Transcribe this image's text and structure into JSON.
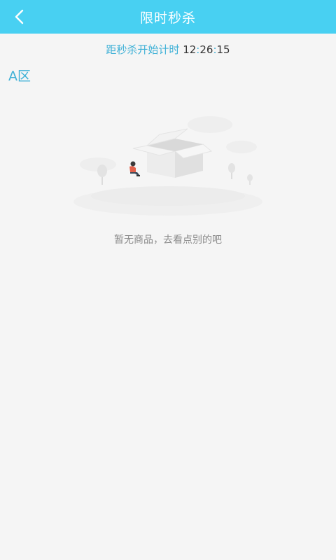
{
  "header": {
    "title": "限时秒杀",
    "back_icon": "chevron-left-icon"
  },
  "countdown": {
    "label": "距秒杀开始计时",
    "hours": "12",
    "minutes": "26",
    "seconds": "15",
    "separator": ":"
  },
  "zone": {
    "label": "A区"
  },
  "empty": {
    "illustration": "empty-box-illustration",
    "message": "暂无商品，去看点别的吧"
  },
  "colors": {
    "header_bg": "#48d0f2",
    "accent": "#3db0d6",
    "page_bg": "#f5f5f5"
  }
}
